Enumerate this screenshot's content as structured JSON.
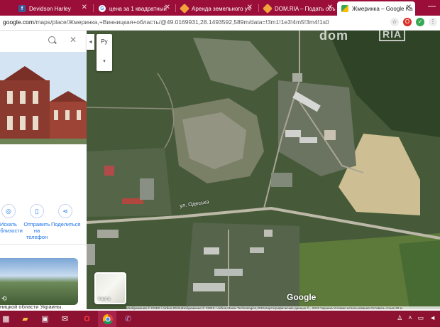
{
  "tabs": [
    {
      "label": "Devidson Harley",
      "favicon": "facebook-icon"
    },
    {
      "label": "цена за 1 квадратный",
      "favicon": "google-icon"
    },
    {
      "label": "Аренда земельного уч",
      "favicon": "domria-icon"
    },
    {
      "label": "DOM.RIA – Подать объ",
      "favicon": "domria-icon"
    },
    {
      "label": "Жмеринка – Google Ka",
      "favicon": "maps-icon",
      "active": true
    }
  ],
  "address": {
    "host": "google.com",
    "path": "/maps/place/Жмеринка,+Винницкая+область/@49.0169931,28.1493592,589m/data=!3m1!1e3!4m5!3m4!1s0x"
  },
  "panel": {
    "actions": [
      {
        "label": "Искать поблизости",
        "icon": "nearby-icon"
      },
      {
        "label": "Отправить на телефон",
        "icon": "phone-icon"
      },
      {
        "label": "Поделиться",
        "icon": "share-icon"
      }
    ],
    "footer": "ницкой области Украины."
  },
  "map": {
    "language_label": "Ру",
    "street_label": "ул. Одеська",
    "layer_label": "Карта",
    "logo": "Google",
    "watermark": "dom ria",
    "attribution": "Изображения © CNES / Airbus,2019,Изображения © CNES / Airbus,Maxar Technologies,2019,Картографические данные © , 2019   Украина   Условия использования   Оставить отзыв   20 м"
  },
  "colors": {
    "tabbar": "#9b0e3a",
    "taskbar": "#8d1130",
    "link_blue": "#1a73e8"
  }
}
